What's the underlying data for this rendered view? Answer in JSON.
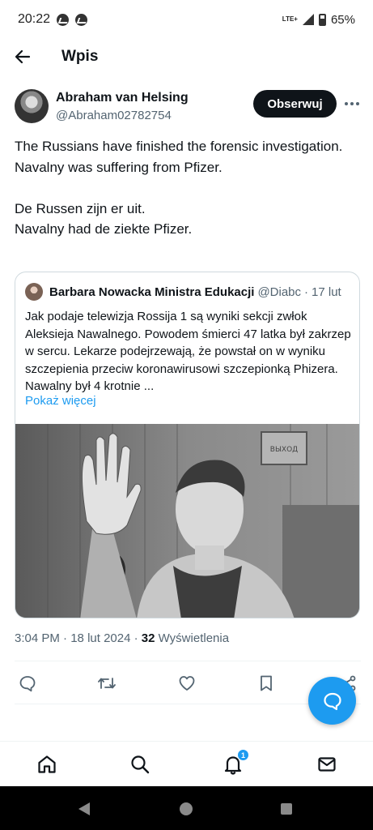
{
  "status_bar": {
    "time": "20:22",
    "network": "LTE+",
    "battery": "65%"
  },
  "header": {
    "title": "Wpis"
  },
  "author": {
    "name": "Abraham van Helsing",
    "handle": "@Abraham02782754",
    "follow_label": "Obserwuj"
  },
  "tweet": {
    "text": "The Russians have finished the forensic investigation.\nNavalny was suffering from Pfizer.\n\nDe Russen zijn er uit.\nNavalny had de ziekte Pfizer."
  },
  "quote": {
    "name": "Barbara Nowacka Ministra Edukacji",
    "handle": "@Diabc",
    "separator": "·",
    "date": "17 lut",
    "text": "Jak podaje telewizja Rossija 1 są wyniki sekcji zwłok Aleksieja Nawalnego. Powodem śmierci 47 latka był zakrzep w sercu. Lekarze podejrzewają, że powstał on w wyniku szczepienia przeciw koronawirusowi szczepionką Phizera. Nawalny był 4 krotnie ...",
    "show_more": "Pokaż więcej",
    "image_sign": "ВЫХОД"
  },
  "meta": {
    "time": "3:04 PM",
    "date": "18 lut 2024",
    "separator": "·",
    "views_count": "32",
    "views_label": "Wyświetlenia"
  },
  "actions": [
    "reply-icon",
    "retweet-icon",
    "like-icon",
    "bookmark-icon",
    "share-icon"
  ],
  "nav": {
    "notifications_badge": "1"
  },
  "colors": {
    "accent": "#1d9bf0",
    "text": "#0f1419",
    "muted": "#536471",
    "border": "#cfd9de"
  }
}
